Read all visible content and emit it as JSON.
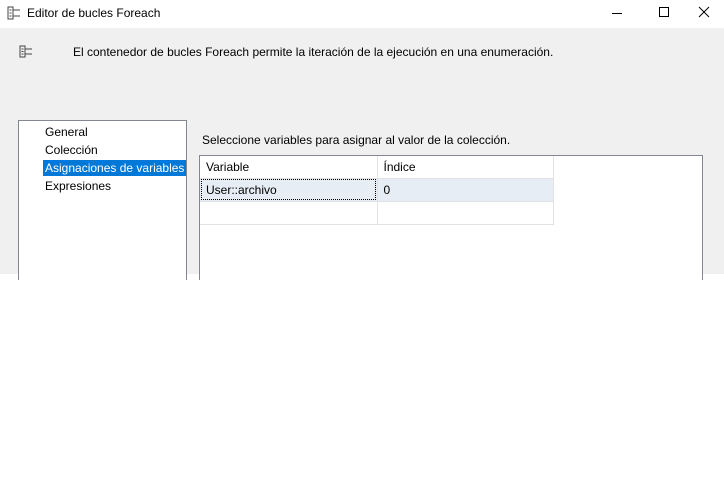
{
  "window": {
    "title": "Editor de bucles Foreach",
    "minimize_symbol": "",
    "maximize_symbol": "",
    "close_symbol": ""
  },
  "header": {
    "description": "El contenedor de bucles Foreach permite la iteración de la ejecución en una enumeración.",
    "icon": "foreach-container-icon"
  },
  "nav": {
    "items": [
      {
        "label": "General",
        "selected": false
      },
      {
        "label": "Colección",
        "selected": false
      },
      {
        "label": "Asignaciones de variables",
        "selected": true
      },
      {
        "label": "Expresiones",
        "selected": false
      }
    ]
  },
  "main": {
    "instruction": "Seleccione variables para asignar al valor de la colección.",
    "grid": {
      "columns": [
        "Variable",
        "Índice"
      ],
      "rows": [
        [
          "User::archivo",
          "0"
        ],
        [
          "",
          ""
        ]
      ]
    }
  },
  "colors": {
    "selection": "#0078d7",
    "row_selection": "#e6edf4",
    "client_background": "#f0f0f0"
  }
}
